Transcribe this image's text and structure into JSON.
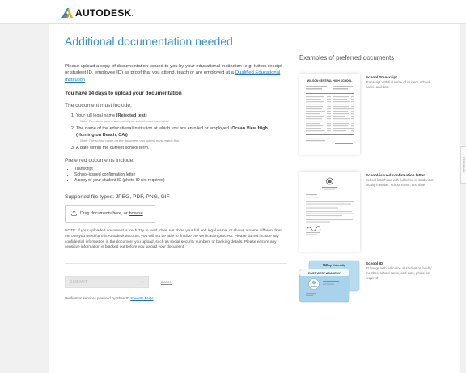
{
  "brand": {
    "name": "AUTODESK."
  },
  "main": {
    "title": "Additional documentation needed",
    "intro_text": "Please upload a copy of documentation issued to you by your educational institution (e.g. tuition receipt or student ID, employee ID) as proof that you attend, teach or are employed at a ",
    "intro_link": "Qualified Educational Institution",
    "deadline": "You have 14 days to upload your documentation",
    "must_include_label": "The document must include:",
    "requirements": [
      {
        "prefix": "Your full legal name ",
        "bold": "(Rejected test)",
        "note": "Note: The name on the document you submit must match this."
      },
      {
        "prefix": "The name of the educational institution at which you are enrolled or employed ",
        "bold": "(Ocean View High (Huntington Beach, CA))",
        "note": "Note: The school name on the document you submit must match this."
      },
      {
        "prefix": "A date within the current school term.",
        "bold": "",
        "note": ""
      }
    ],
    "preferred_label": "Preferred documents include:",
    "preferred": [
      "Transcript",
      "School-issued confirmation letter",
      "A copy of your student ID (photo ID not required)"
    ],
    "file_types": "Supported file types: JPEG, PDF, PNG, GIF",
    "dropzone_text": "Drag documents here, or",
    "dropzone_browse": "browse",
    "warning": "NOTE: If your uploaded document is too fuzzy to read, does not show your full and legal name, or shows a name different from the one you used for this Autodesk account, you will not be able to finalize the verification process. Please do not include any confidential information in the document you upload, such as social security numbers or banking details. Please ensure any sensitive information is blacked out before you upload your document.",
    "submit_label": "SUBMIT",
    "cancel_label": "Cancel",
    "footer_text": "Verification services powered by SheerID",
    "footer_link": "SheerID FAQs"
  },
  "side": {
    "title": "Examples of preferred documents",
    "examples": [
      {
        "title": "School Transcript",
        "desc": "Transcript with full name of student, school name, and date"
      },
      {
        "title": "School-issued confirmation letter",
        "desc": "School letterhead with full name of student or faculty member, school name, and date"
      },
      {
        "title": "School ID",
        "desc": "ID badge with full name of student or faculty member, school name, and date, photo not required"
      }
    ],
    "thumb_texts": {
      "transcript_header": "WILSON CENTRAL HIGH SCHOOL",
      "id_school_back": "Hilltop University",
      "id_school_front": "EAST WEST ACADEMY"
    }
  },
  "feedback_label": "FEEDBACK",
  "colors": {
    "accent": "#3b8fcf",
    "link": "#1a76c2",
    "page_bg": "#f1f1f1",
    "card_bg": "#ffffff",
    "id_card": "#a9d3ea"
  },
  "icons": {
    "logo": "autodesk-logo-icon",
    "upload": "upload-icon",
    "dropdown": "chevron-down-icon"
  }
}
